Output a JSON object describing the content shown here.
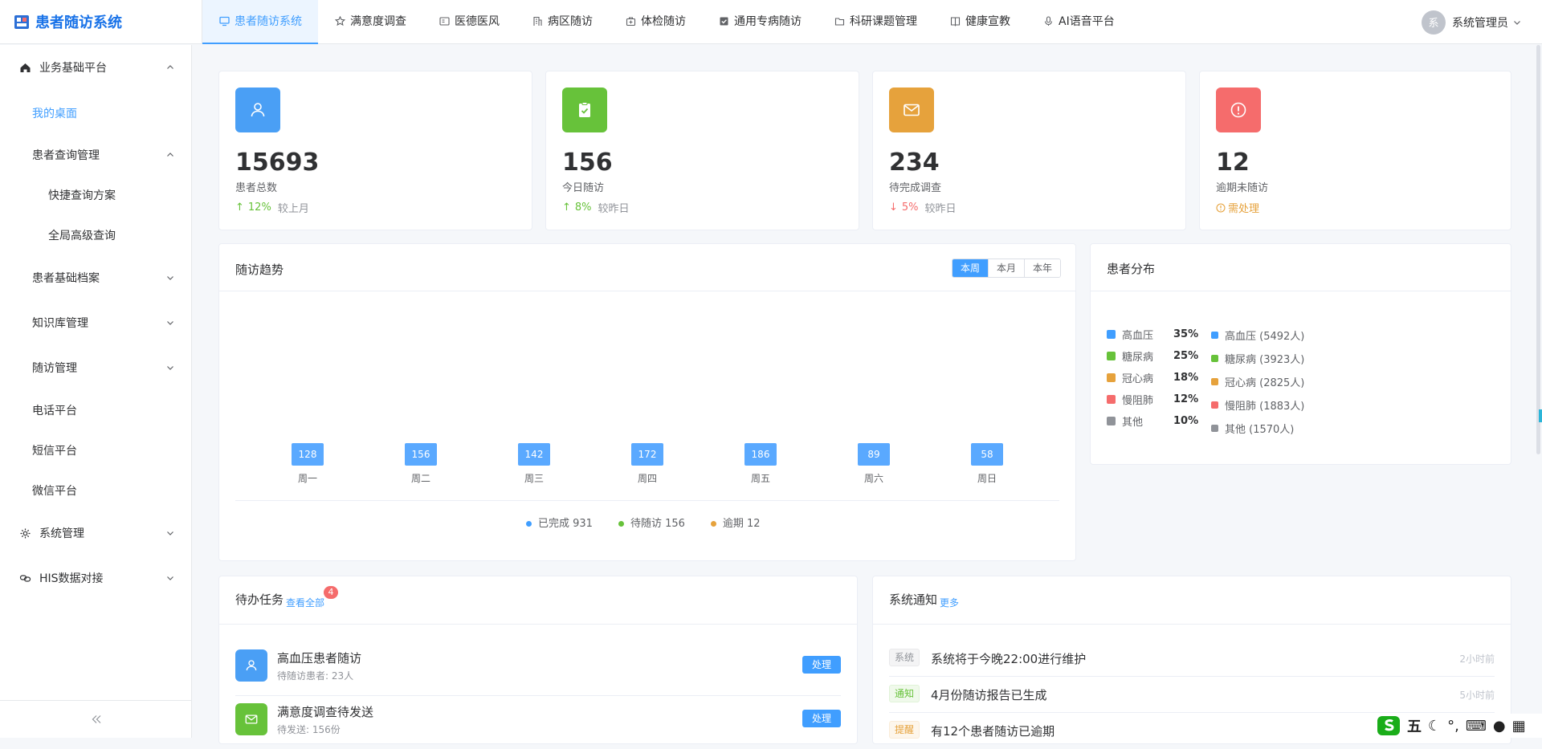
{
  "app": {
    "title": "患者随访系统"
  },
  "nav": [
    {
      "label": "患者随访系统",
      "icon": "monitor-icon",
      "active": true
    },
    {
      "label": "满意度调查",
      "icon": "star-icon"
    },
    {
      "label": "医德医风",
      "icon": "id-card-icon"
    },
    {
      "label": "病区随访",
      "icon": "building-icon"
    },
    {
      "label": "体检随访",
      "icon": "briefcase-medical-icon"
    },
    {
      "label": "通用专病随访",
      "icon": "checkbox-icon"
    },
    {
      "label": "科研课题管理",
      "icon": "folder-icon"
    },
    {
      "label": "健康宣教",
      "icon": "book-icon"
    },
    {
      "label": "AI语音平台",
      "icon": "microphone-icon"
    }
  ],
  "user": {
    "avatar_text": "系",
    "name": "系统管理员"
  },
  "sidebar": {
    "items": [
      {
        "label": "业务基础平台",
        "icon": "home-icon",
        "expanded": true
      },
      {
        "label": "我的桌面",
        "active": true
      },
      {
        "label": "患者查询管理",
        "expanded": true
      },
      {
        "label": "快捷查询方案"
      },
      {
        "label": "全局高级查询"
      },
      {
        "label": "患者基础档案"
      },
      {
        "label": "知识库管理"
      },
      {
        "label": "随访管理"
      },
      {
        "label": "电话平台"
      },
      {
        "label": "短信平台"
      },
      {
        "label": "微信平台"
      },
      {
        "label": "系统管理",
        "icon": "gear-icon"
      },
      {
        "label": "HIS数据对接",
        "icon": "link-icon"
      }
    ]
  },
  "stats": [
    {
      "value": "15693",
      "label": "患者总数",
      "trend": "12%",
      "compare": "较上月",
      "direction": "up",
      "color": "#4a9ff5",
      "icon": "user-icon"
    },
    {
      "value": "156",
      "label": "今日随访",
      "trend": "8%",
      "compare": "较昨日",
      "direction": "up",
      "color": "#67c23a",
      "icon": "clipboard-check-icon"
    },
    {
      "value": "234",
      "label": "待完成调查",
      "trend": "5%",
      "compare": "较昨日",
      "direction": "down",
      "color": "#e6a23c",
      "icon": "envelope-icon"
    },
    {
      "value": "12",
      "label": "逾期未随访",
      "trend": "需处理",
      "compare": "",
      "direction": "warn",
      "color": "#f56c6c",
      "icon": "alert-circle-icon"
    }
  ],
  "trend": {
    "title": "随访趋势",
    "ranges": [
      "本周",
      "本月",
      "本年"
    ],
    "active_range": "本周",
    "legend": [
      {
        "label": "已完成 931",
        "color": "#409eff"
      },
      {
        "label": "待随访 156",
        "color": "#67c23a"
      },
      {
        "label": "逾期 12",
        "color": "#e6a23c"
      }
    ]
  },
  "chart_data": {
    "type": "bar",
    "categories": [
      "周一",
      "周二",
      "周三",
      "周四",
      "周五",
      "周六",
      "周日"
    ],
    "values": [
      128,
      156,
      142,
      172,
      186,
      89,
      58
    ]
  },
  "distribution": {
    "title": "患者分布",
    "items": [
      {
        "name": "高血压",
        "pct": "35%",
        "detail": "高血压 (5492人)",
        "color": "#409eff"
      },
      {
        "name": "糖尿病",
        "pct": "25%",
        "detail": "糖尿病 (3923人)",
        "color": "#67c23a"
      },
      {
        "name": "冠心病",
        "pct": "18%",
        "detail": "冠心病 (2825人)",
        "color": "#e6a23c"
      },
      {
        "name": "慢阻肺",
        "pct": "12%",
        "detail": "慢阻肺 (1883人)",
        "color": "#f56c6c"
      },
      {
        "name": "其他",
        "pct": "10%",
        "detail": "其他 (1570人)",
        "color": "#909399"
      }
    ]
  },
  "tasks": {
    "title": "待办任务",
    "view_all": "查看全部",
    "badge": "4",
    "items": [
      {
        "title": "高血压患者随访",
        "sub": "待随访患者: 23人",
        "button": "处理",
        "color": "#4a9ff5",
        "icon": "user-icon"
      },
      {
        "title": "满意度调查待发送",
        "sub": "待发送: 156份",
        "button": "处理",
        "color": "#67c23a",
        "icon": "envelope-icon"
      }
    ]
  },
  "notices": {
    "title": "系统通知",
    "more": "更多",
    "items": [
      {
        "tag": "系统",
        "text": "系统将于今晚22:00进行维护",
        "time": "2小时前",
        "tag_color": "#909399",
        "tag_bg": "#f4f4f5"
      },
      {
        "tag": "通知",
        "text": "4月份随访报告已生成",
        "time": "5小时前",
        "tag_color": "#67c23a",
        "tag_bg": "#f0f9eb"
      },
      {
        "tag": "提醒",
        "text": "有12个患者随访已逾期",
        "time": "",
        "tag_color": "#e6a23c",
        "tag_bg": "#fdf6ec"
      }
    ]
  },
  "ime": {
    "label": "五"
  }
}
